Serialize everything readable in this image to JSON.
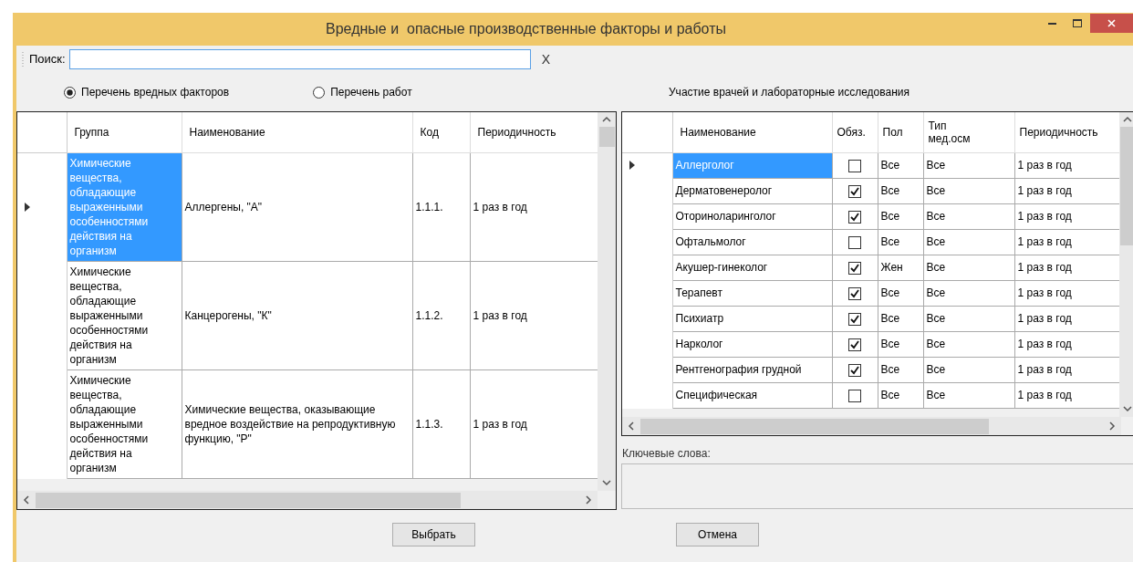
{
  "window": {
    "title": "Вредные и  опасные производственные факторы и работы"
  },
  "search": {
    "label": "Поиск:",
    "clear": "X"
  },
  "radios": [
    {
      "label": "Перечень вредных факторов",
      "selected": true
    },
    {
      "label": "Перечень работ",
      "selected": false
    }
  ],
  "factors_table": {
    "columns": [
      "Группа",
      "Наименование",
      "Код",
      "Периодичность"
    ],
    "rows": [
      {
        "current": true,
        "cells": [
          "Химические вещества, обладающие выраженными особенностями действия на организм",
          "Аллергены, \"А\"",
          "1.1.1.",
          "1 раз в год"
        ]
      },
      {
        "current": false,
        "cells": [
          "Химические вещества, обладающие выраженными особенностями действия на организм",
          "Канцерогены, \"К\"",
          "1.1.2.",
          "1 раз в год"
        ]
      },
      {
        "current": false,
        "cells": [
          "Химические вещества, обладающие выраженными особенностями действия на организм",
          "Химические вещества, оказывающие вредное воздействие на репродуктивную функцию, \"Р\"",
          "1.1.3.",
          "1 раз в год"
        ]
      }
    ]
  },
  "doctors_panel": {
    "title": "Участие врачей и лабораторные исследования",
    "columns": [
      "Наименование",
      "Обяз.",
      "Пол",
      "Тип мед.осм",
      "Периодичность"
    ],
    "rows": [
      {
        "current": true,
        "name": "Аллерголог",
        "checked": false,
        "sex": "Все",
        "type": "Все",
        "period": "1 раз в год"
      },
      {
        "current": false,
        "name": "Дерматовенеролог",
        "checked": true,
        "sex": "Все",
        "type": "Все",
        "period": "1 раз в год"
      },
      {
        "current": false,
        "name": "Оториноларинголог",
        "checked": true,
        "sex": "Все",
        "type": "Все",
        "period": "1 раз в год"
      },
      {
        "current": false,
        "name": "Офтальмолог",
        "checked": false,
        "sex": "Все",
        "type": "Все",
        "period": "1 раз в год"
      },
      {
        "current": false,
        "name": "Акушер-гинеколог",
        "checked": true,
        "sex": "Жен",
        "type": "Все",
        "period": "1 раз в год"
      },
      {
        "current": false,
        "name": "Терапевт",
        "checked": true,
        "sex": "Все",
        "type": "Все",
        "period": "1 раз в год"
      },
      {
        "current": false,
        "name": "Психиатр",
        "checked": true,
        "sex": "Все",
        "type": "Все",
        "period": "1 раз в год"
      },
      {
        "current": false,
        "name": "Нарколог",
        "checked": true,
        "sex": "Все",
        "type": "Все",
        "period": "1 раз в год"
      },
      {
        "current": false,
        "name": "Рентгенография грудной",
        "checked": true,
        "sex": "Все",
        "type": "Все",
        "period": "1 раз в год"
      },
      {
        "current": false,
        "name": "Специфическая",
        "checked": false,
        "sex": "Все",
        "type": "Все",
        "period": "1 раз в год"
      }
    ]
  },
  "keywords": {
    "label": "Ключевые слова:"
  },
  "buttons": [
    "Выбрать",
    "Отмена"
  ]
}
